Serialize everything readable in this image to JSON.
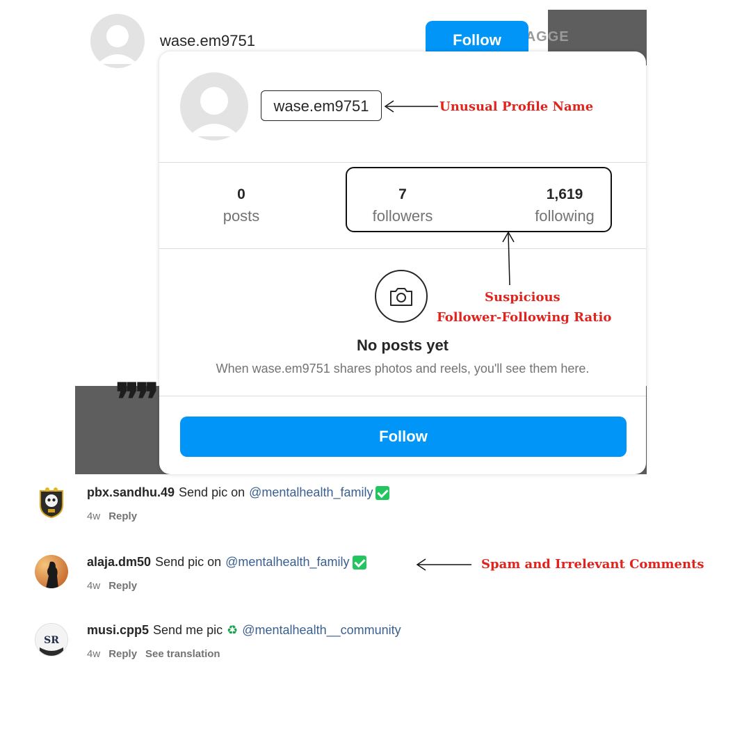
{
  "top": {
    "username": "wase.em9751",
    "follow_label": "Follow",
    "tagged_label": "TAGGE"
  },
  "card": {
    "username": "wase.em9751",
    "stats": [
      {
        "value": "0",
        "label": "posts"
      },
      {
        "value": "7",
        "label": "followers"
      },
      {
        "value": "1,619",
        "label": "following"
      }
    ],
    "empty_title": "No posts yet",
    "empty_subtitle": "When wase.em9751 shares photos and reels, you'll see them here.",
    "follow_label": "Follow"
  },
  "annotations": {
    "profile_name": "Unusual Profile Name",
    "ratio_line1": "Suspicious",
    "ratio_line2": "Follower-Following Ratio",
    "comments": "Spam and Irrelevant Comments"
  },
  "comments": [
    {
      "user": "pbx.sandhu.49",
      "text": "Send pic on",
      "mention": "@mentalhealth_family",
      "time": "4w",
      "reply": "Reply",
      "translate": ""
    },
    {
      "user": "alaja.dm50",
      "text": "Send pic on",
      "mention": "@mentalhealth_family",
      "time": "4w",
      "reply": "Reply",
      "translate": ""
    },
    {
      "user": "musi.cpp5",
      "text": "Send me pic",
      "mention": "@mentalhealth__community",
      "time": "4w",
      "reply": "Reply",
      "translate": "See translation"
    }
  ],
  "colors": {
    "accent": "#0095f6",
    "annotation": "#e0231c",
    "check": "#22c55e"
  }
}
